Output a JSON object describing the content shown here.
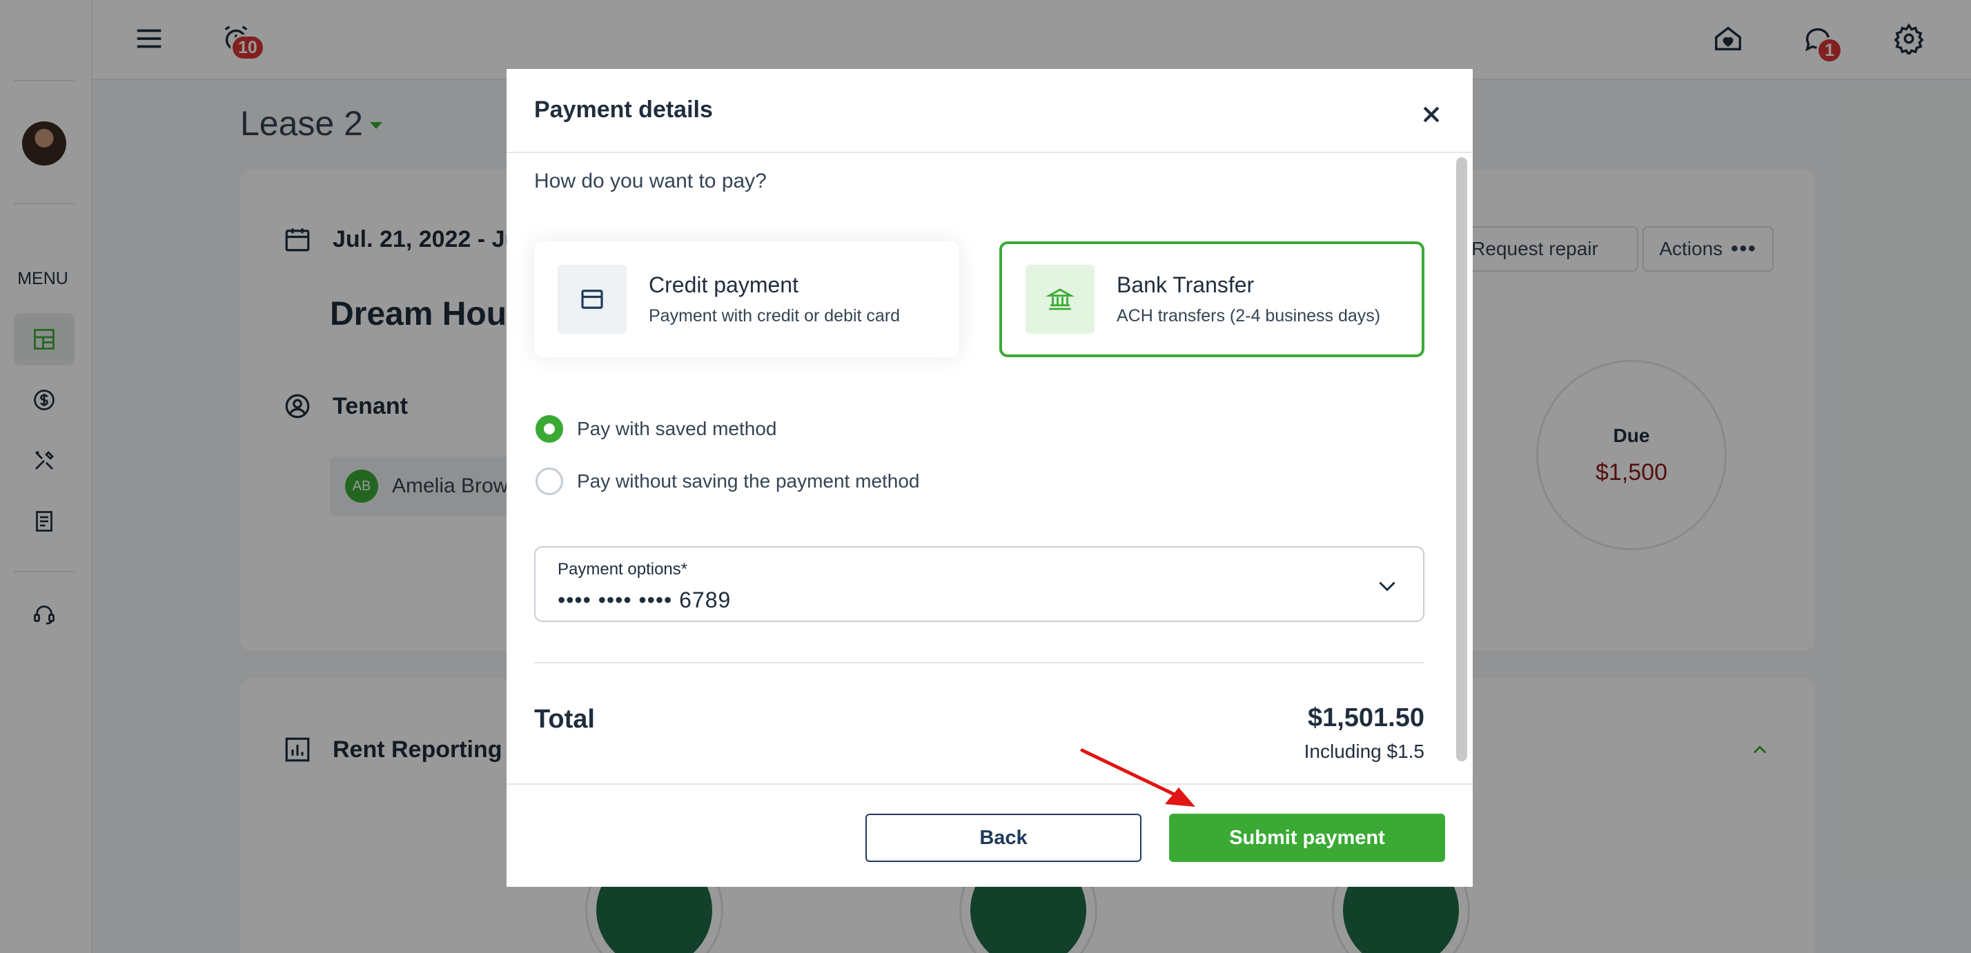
{
  "app": {
    "sidebar": {
      "menu_label": "MENU",
      "items": [
        {
          "icon": "dashboard-icon",
          "active": true
        },
        {
          "icon": "dollar-icon",
          "active": false
        },
        {
          "icon": "tools-icon",
          "active": false
        },
        {
          "icon": "document-icon",
          "active": false
        },
        {
          "icon": "support-headset-icon",
          "active": false
        }
      ]
    },
    "topbar": {
      "alerts_badge": "10",
      "messages_badge": "1"
    },
    "lease_title": "Lease 2",
    "lease": {
      "dates": "Jul. 21, 2022 - Ju",
      "property": "Dream Hou",
      "tenant_heading": "Tenant",
      "tenant_initials": "AB",
      "tenant_name": "Amelia Brow",
      "request_repair": "Request repair",
      "actions": "Actions",
      "due_label": "Due",
      "due_amount": "$1,500"
    },
    "rent_reporting": "Rent Reporting"
  },
  "modal": {
    "title": "Payment details",
    "question": "How do you want to pay?",
    "methods": [
      {
        "title": "Credit payment",
        "subtitle": "Payment with credit or debit card",
        "selected": false
      },
      {
        "title": "Bank Transfer",
        "subtitle": "ACH transfers (2-4 business days)",
        "selected": true
      }
    ],
    "radios": [
      {
        "label": "Pay with saved method",
        "checked": true
      },
      {
        "label": "Pay without saving the payment method",
        "checked": false
      }
    ],
    "payment_options": {
      "label": "Payment options*",
      "value": "•••• •••• •••• 6789"
    },
    "total": {
      "label": "Total",
      "amount": "$1,501.50",
      "sub": "Including $1.5"
    },
    "buttons": {
      "back": "Back",
      "submit": "Submit payment"
    }
  },
  "colors": {
    "brand_green": "#3aaa35",
    "due_red": "#8b1a1a",
    "badge_red": "#d93636"
  }
}
